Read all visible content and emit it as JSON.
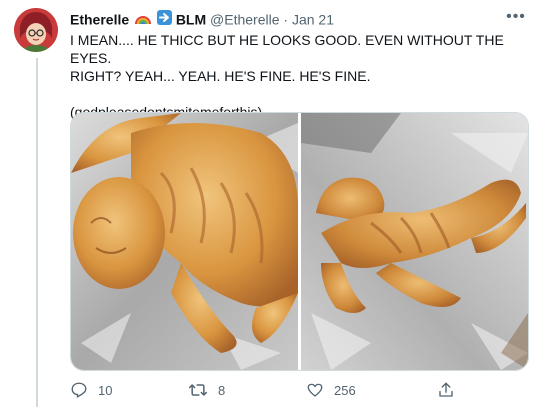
{
  "tweet": {
    "display_name": "Etherelle",
    "badge_text": "BLM",
    "handle": "@Etherelle",
    "separator": "·",
    "date": "Jan 21",
    "more_label": "•••",
    "line1": "I MEAN.... HE THICC BUT HE LOOKS GOOD. EVEN WITHOUT THE EYES.",
    "line2": "RIGHT? YEAH... YEAH. HE'S FINE. HE'S FINE.",
    "line3": "(godpleasedontsmitemeforthis)"
  },
  "actions": {
    "reply_count": "10",
    "retweet_count": "8",
    "like_count": "256"
  },
  "icons": {
    "reply": "reply-icon",
    "retweet": "retweet-icon",
    "like": "heart-icon",
    "share": "share-icon",
    "rainbow": "rainbow-emoji-icon",
    "arrow": "right-arrow-emoji-icon"
  },
  "colors": {
    "text": "#0f1419",
    "secondary": "#536471",
    "border": "#cfd9de",
    "arrow_badge": "#3b94d9"
  }
}
